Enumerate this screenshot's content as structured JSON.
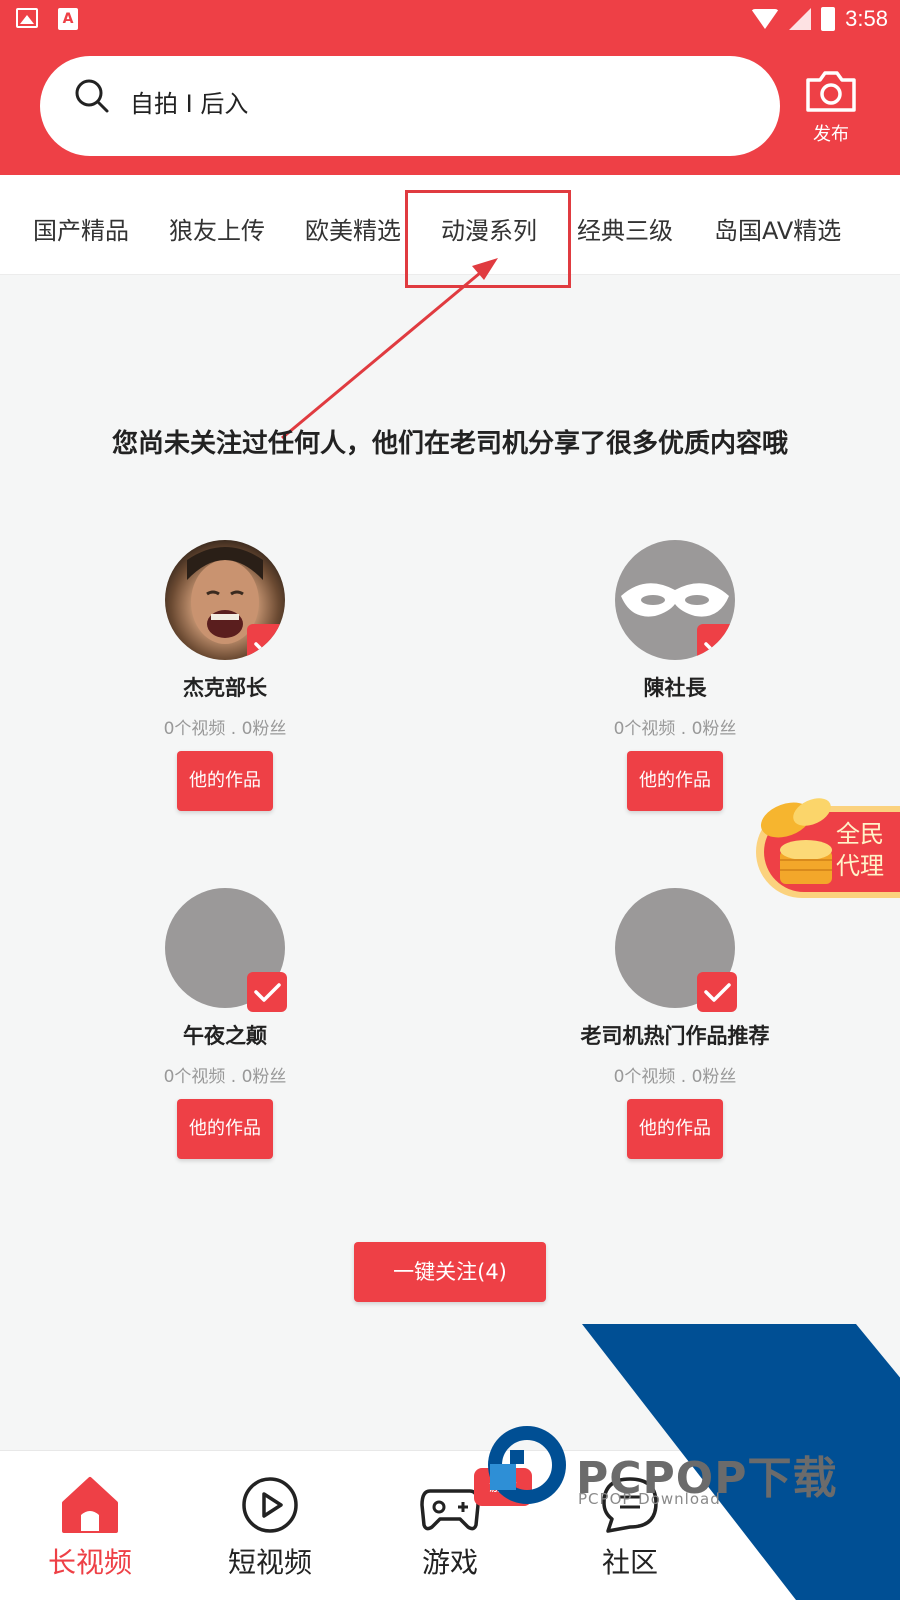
{
  "status_bar": {
    "time": "3:58"
  },
  "header": {
    "search_placeholder": "自拍 I 后入",
    "publish_label": "发布"
  },
  "tabs": [
    {
      "label": "国产精品"
    },
    {
      "label": "狼友上传"
    },
    {
      "label": "欧美精选"
    },
    {
      "label": "动漫系列"
    },
    {
      "label": "经典三级"
    },
    {
      "label": "岛国AV精选"
    }
  ],
  "empty_message": "您尚未关注过任何人，他们在老司机分享了很多优质内容哦",
  "users": [
    {
      "name": "杰克部长",
      "stats": "0个视频 . 0粉丝",
      "button": "他的作品",
      "checked": true
    },
    {
      "name": "陳社長",
      "stats": "0个视频 . 0粉丝",
      "button": "他的作品",
      "checked": true
    },
    {
      "name": "午夜之颠",
      "stats": "0个视频 . 0粉丝",
      "button": "他的作品",
      "checked": true
    },
    {
      "name": "老司机热门作品推荐",
      "stats": "0个视频 . 0粉丝",
      "button": "他的作品",
      "checked": true
    }
  ],
  "follow_all_label": "一键关注(4)",
  "agent_badge": {
    "line1": "全民",
    "line2": "代理"
  },
  "bottom_nav": [
    {
      "label": "长视频",
      "icon": "home-icon",
      "active": true
    },
    {
      "label": "短视频",
      "icon": "play-circle-icon",
      "active": false
    },
    {
      "label": "游戏",
      "icon": "gamepad-icon",
      "active": false
    },
    {
      "label": "社区",
      "icon": "chat-icon",
      "active": false
    }
  ],
  "game_badge": "游戏",
  "watermark": {
    "title": "PCPOP下载",
    "subtitle": "PCPOP Download"
  },
  "colors": {
    "accent": "#ee4046",
    "background": "#f5f6f6",
    "watermark_blue": "#004f94"
  }
}
